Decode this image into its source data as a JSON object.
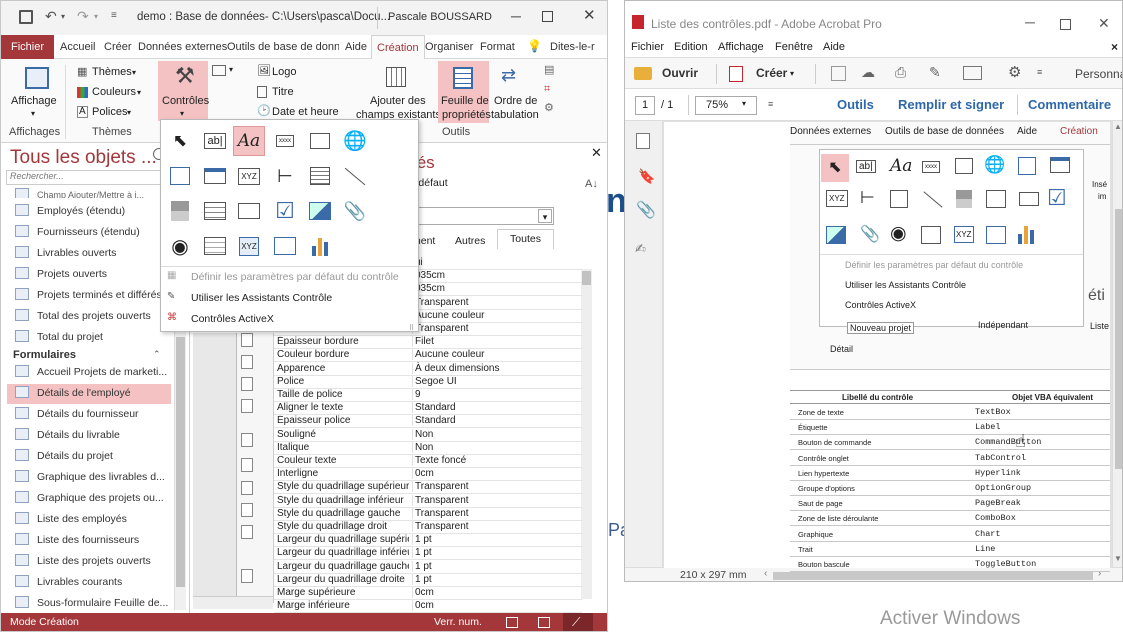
{
  "access": {
    "title": "demo : Base de données- C:\\Users\\pasca\\Docu...",
    "user": "Pascale BOUSSARD",
    "tabs": [
      "Fichier",
      "Accueil",
      "Créer",
      "Données externes",
      "Outils de base de donné",
      "Aide",
      "Création",
      "Organiser",
      "Format"
    ],
    "tell": "Dites-le-r",
    "ribbon": {
      "affichage": "Affichage",
      "affichages": "Affichages",
      "themes": "Thèmes",
      "couleurs": "Couleurs",
      "polices": "Polices",
      "themes_group": "Thèmes",
      "controles": "Contrôles",
      "logo": "Logo",
      "titre": "Titre",
      "date": "Date et heure",
      "ajouter": "Ajouter des",
      "champs": "champs existants",
      "feuille": "Feuille de",
      "proprietes": "propriétés",
      "ordre": "Ordre de",
      "tabulation": "tabulation",
      "outils": "Outils"
    },
    "gallery": {
      "menu": [
        "Définir les paramètres par défaut du contrôle",
        "Utiliser les Assistants Contrôle",
        "Contrôles ActiveX"
      ]
    },
    "nav": {
      "title": "Tous les objets ...",
      "search": "Rechercher...",
      "partial": "Champ Ajouter/Mettre à j...",
      "items1": [
        "Employés (étendu)",
        "Fournisseurs (étendu)",
        "Livrables ouverts",
        "Projets ouverts",
        "Projets terminés et différés",
        "Total des projets ouverts",
        "Total du projet"
      ],
      "section": "Formulaires",
      "items2": [
        "Accueil Projets de marketi...",
        "Détails de l'employé",
        "Détails du fournisseur",
        "Détails du livrable",
        "Détails du projet",
        "Graphique des livrables d...",
        "Graphique des projets ou...",
        "Liste des employés",
        "Liste des fournisseurs",
        "Liste des projets ouverts",
        "Livrables courants",
        "Sous-formulaire Feuille de..."
      ]
    },
    "props": {
      "title": "tés",
      "sub": "r défaut",
      "tabs": [
        "ment",
        "Autres",
        "Toutes"
      ],
      "rows": [
        [
          "",
          "ui"
        ],
        [
          "",
          "035cm"
        ],
        [
          "",
          "035cm"
        ],
        [
          "",
          "Transparent"
        ],
        [
          "",
          "Aucune couleur"
        ],
        [
          "",
          "Transparent"
        ],
        [
          "Épaisseur bordure",
          "Filet"
        ],
        [
          "Couleur bordure",
          "Aucune couleur"
        ],
        [
          "Apparence",
          "À deux dimensions"
        ],
        [
          "Police",
          "Segoe UI"
        ],
        [
          "Taille de police",
          "9"
        ],
        [
          "Aligner le texte",
          "Standard"
        ],
        [
          "Épaisseur police",
          "Standard"
        ],
        [
          "Souligné",
          "Non"
        ],
        [
          "Italique",
          "Non"
        ],
        [
          "Couleur texte",
          "Texte foncé"
        ],
        [
          "Interligne",
          "0cm"
        ],
        [
          "Style du quadrillage supérieur",
          "Transparent"
        ],
        [
          "Style du quadrillage inférieur",
          "Transparent"
        ],
        [
          "Style du quadrillage gauche",
          "Transparent"
        ],
        [
          "Style du quadrillage droit",
          "Transparent"
        ],
        [
          "Largeur du quadrillage supérieur",
          "1 pt"
        ],
        [
          "Largeur du quadrillage inférieur",
          "1 pt"
        ],
        [
          "Largeur du quadrillage gauche",
          "1 pt"
        ],
        [
          "Largeur du quadrillage droite",
          "1 pt"
        ],
        [
          "Marge supérieure",
          "0cm"
        ],
        [
          "Marge inférieure",
          "0cm"
        ]
      ]
    },
    "status": {
      "mode": "Mode Création",
      "verr": "Verr. num."
    }
  },
  "acrobat": {
    "title": "Liste des contrôles.pdf - Adobe Acrobat Pro",
    "menu": [
      "Fichier",
      "Edition",
      "Affichage",
      "Fenêtre",
      "Aide"
    ],
    "open": "Ouvrir",
    "create": "Créer",
    "persona": "Personna",
    "page": "1",
    "pages": "/ 1",
    "zoom": "75%",
    "tools": [
      "Outils",
      "Remplir et signer",
      "Commentaire"
    ],
    "size": "210 x 297 mm",
    "pdf_tabs": [
      "Données externes",
      "Outils de base de données",
      "Aide",
      "Création"
    ],
    "pdf_menu": [
      "Définir les paramètres par défaut du contrôle",
      "Utiliser les Assistants Contrôle",
      "Contrôles ActiveX"
    ],
    "pdf_misc": {
      "nouveau": "Nouveau projet",
      "independant": "Indépendant",
      "detail": "Détail",
      "liste": "Liste",
      "ins": "Insé",
      "im": "im",
      "eti": "éti"
    },
    "table": {
      "h1": "Libellé du contrôle",
      "h2": "Objet VBA équivalent",
      "rows": [
        [
          "Zone de texte",
          "TextBox"
        ],
        [
          "Étiquette",
          "Label"
        ],
        [
          "Bouton de commande",
          "CommandButton"
        ],
        [
          "Contrôle onglet",
          "TabControl"
        ],
        [
          "Lien hypertexte",
          "Hyperlink"
        ],
        [
          "Groupe d'options",
          "OptionGroup"
        ],
        [
          "Saut de page",
          "PageBreak"
        ],
        [
          "Zone de liste déroulante",
          "ComboBox"
        ],
        [
          "Graphique",
          "Chart"
        ],
        [
          "Trait",
          "Line"
        ],
        [
          "Bouton bascule",
          "ToggleButton"
        ]
      ]
    }
  },
  "background": {
    "activate": "Activer Windows",
    "frag_n": "n",
    "frag_pa": "Pa"
  },
  "colors": {
    "access_red": "#a4373a",
    "highlight": "#f4c2c2",
    "acrobat_red": "#c5252b"
  }
}
